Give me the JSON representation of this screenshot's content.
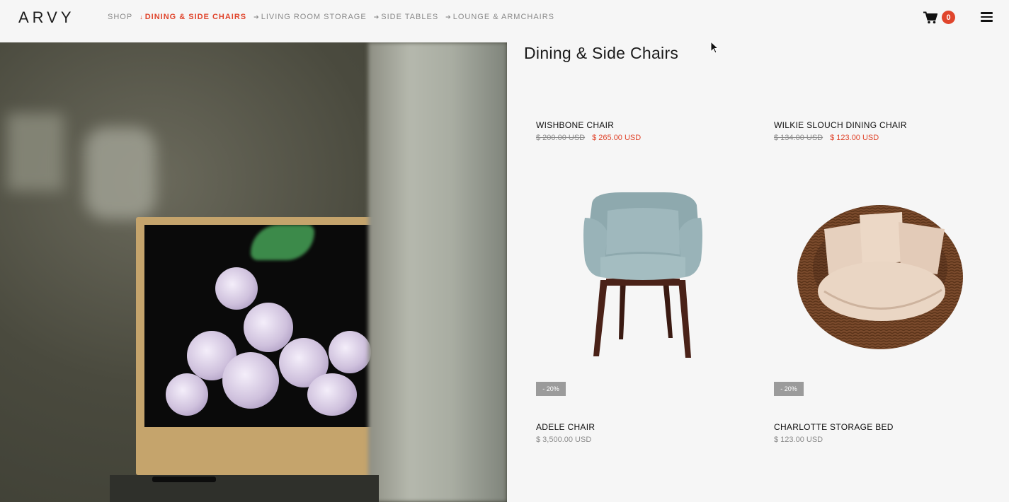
{
  "header": {
    "logo": "ARVY",
    "nav": [
      {
        "label": "SHOP",
        "arrow": ""
      },
      {
        "label": "DINING & SIDE CHAIRS",
        "arrow": "↓"
      },
      {
        "label": "LIVING ROOM STORAGE",
        "arrow": "➔"
      },
      {
        "label": "SIDE TABLES",
        "arrow": "➔"
      },
      {
        "label": "LOUNGE & ARMCHAIRS",
        "arrow": "➔"
      }
    ],
    "cart_count": "0",
    "cart_icon": "cart-icon",
    "menu_icon": "hamburger-menu-icon"
  },
  "page": {
    "title": "Dining & Side Chairs"
  },
  "products": [
    {
      "name": "WISHBONE CHAIR",
      "old_price": "$ 200.00 USD",
      "price": "$ 265.00 USD"
    },
    {
      "name": "WILKIE SLOUCH DINING CHAIR",
      "old_price": "$ 134.00 USD",
      "price": "$ 123.00 USD"
    },
    {
      "name": "ADELE CHAIR",
      "price": "$ 3,500.00 USD",
      "badge": "- 20%"
    },
    {
      "name": "CHARLOTTE STORAGE BED",
      "price": "$ 123.00 USD",
      "badge": "- 20%"
    }
  ],
  "colors": {
    "accent": "#e0452c",
    "background": "#f6f6f6",
    "muted": "#8a8a8a"
  }
}
